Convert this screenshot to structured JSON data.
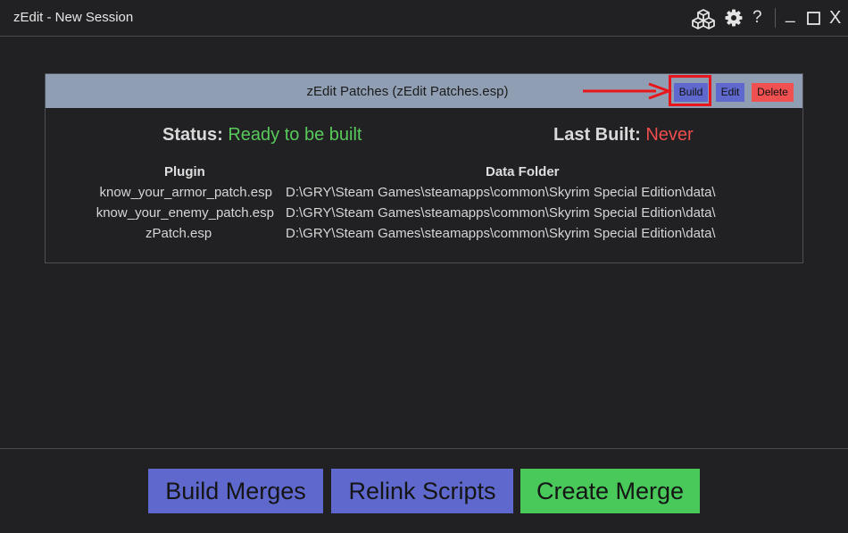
{
  "window": {
    "title": "zEdit - New Session",
    "icons": {
      "modules": "cubes-icon",
      "settings": "gear-icon",
      "help_glyph": "?",
      "minimize_glyph": "_",
      "maximize": "square-icon",
      "close_glyph": "X"
    }
  },
  "patch": {
    "title": "zEdit Patches (zEdit Patches.esp)",
    "buttons": {
      "build": "Build",
      "edit": "Edit",
      "delete": "Delete"
    },
    "status_label": "Status:",
    "status_value": "Ready to be built",
    "last_built_label": "Last Built:",
    "last_built_value": "Never",
    "columns": {
      "plugin": "Plugin",
      "data_folder": "Data Folder"
    },
    "rows": [
      {
        "plugin": "know_your_armor_patch.esp",
        "folder": "D:\\GRY\\Steam Games\\steamapps\\common\\Skyrim Special Edition\\data\\"
      },
      {
        "plugin": "know_your_enemy_patch.esp",
        "folder": "D:\\GRY\\Steam Games\\steamapps\\common\\Skyrim Special Edition\\data\\"
      },
      {
        "plugin": "zPatch.esp",
        "folder": "D:\\GRY\\Steam Games\\steamapps\\common\\Skyrim Special Edition\\data\\"
      }
    ]
  },
  "footer": {
    "build_merges": "Build Merges",
    "relink_scripts": "Relink Scripts",
    "create_merge": "Create Merge"
  },
  "colors": {
    "background": "#212124",
    "panel_header": "#8f9eb2",
    "primary_button": "#5f68cc",
    "success": "#48c95a",
    "danger": "#f05050",
    "annotation": "#e8151c"
  }
}
